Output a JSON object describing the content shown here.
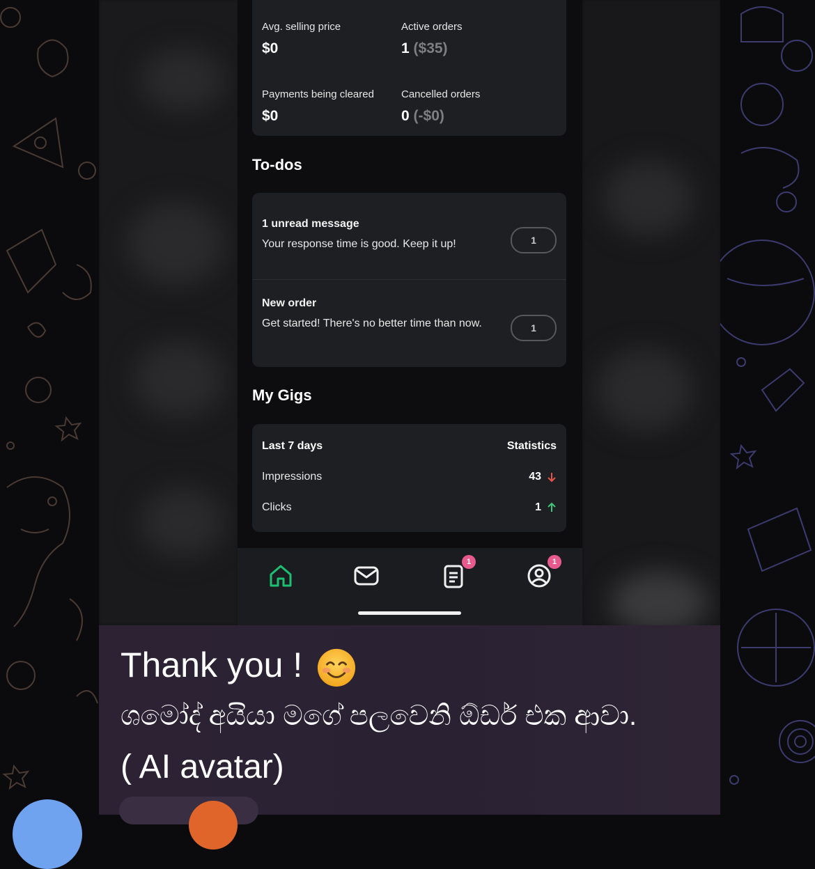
{
  "stats": {
    "avg_selling_price_label": "Avg. selling price",
    "avg_selling_price_value": "$0",
    "active_orders_label": "Active orders",
    "active_orders_count": "1",
    "active_orders_amount": "($35)",
    "payments_label": "Payments being cleared",
    "payments_value": "$0",
    "cancelled_label": "Cancelled orders",
    "cancelled_count": "0",
    "cancelled_amount": "(-$0)"
  },
  "todos": {
    "title": "To-dos",
    "items": [
      {
        "title": "1 unread message",
        "desc": "Your response time is good. Keep it up!",
        "count": "1"
      },
      {
        "title": "New order",
        "desc": "Get started! There's no better time than now.",
        "count": "1"
      }
    ]
  },
  "gigs": {
    "title": "My Gigs",
    "period": "Last 7 days",
    "statistics_label": "Statistics",
    "rows": [
      {
        "label": "Impressions",
        "value": "43",
        "trend": "down"
      },
      {
        "label": "Clicks",
        "value": "1",
        "trend": "up"
      }
    ]
  },
  "tabbar": {
    "items": [
      {
        "icon": "home-icon",
        "active": true
      },
      {
        "icon": "mail-icon"
      },
      {
        "icon": "orders-icon",
        "badge": "1"
      },
      {
        "icon": "profile-icon",
        "badge": "1"
      }
    ]
  },
  "caption": {
    "line1": "Thank you !",
    "line2": "ශමෝද් අයියා මගේ පලවෙනි ඕඩර් එක ආවා.",
    "line3": "( AI avatar)"
  },
  "colors": {
    "accent_green": "#1dbf73",
    "down_red": "#e5534b",
    "up_green": "#3cc47c",
    "badge_pink": "#e85a8c"
  }
}
